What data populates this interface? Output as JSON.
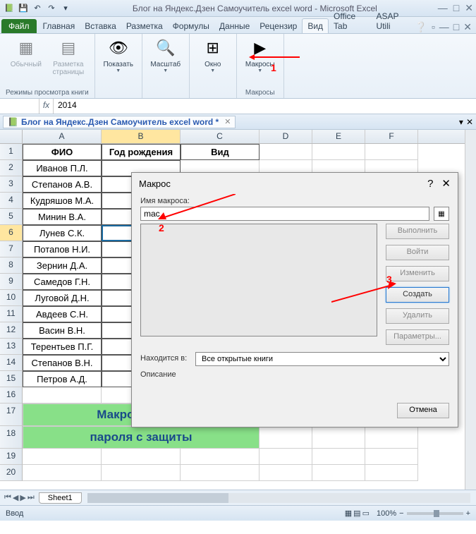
{
  "title": "Блог на Яндекс.Дзен Самоучитель excel word  -  Microsoft Excel",
  "tabs": {
    "file": "Файл",
    "items": [
      "Главная",
      "Вставка",
      "Разметка",
      "Формулы",
      "Данные",
      "Рецензир",
      "Вид",
      "Office Tab",
      "ASAP Utili"
    ],
    "active": "Вид"
  },
  "ribbon": {
    "group1_label": "Режимы просмотра книги",
    "btn_normal": "Обычный",
    "btn_layout": "Разметка страницы",
    "group2_label": "",
    "btn_show": "Показать",
    "group3_label": "",
    "btn_zoom": "Масштаб",
    "group4_label": "",
    "btn_window": "Окно",
    "group5_label": "Макросы",
    "btn_macros": "Макросы"
  },
  "formula": {
    "name": "",
    "value": "2014"
  },
  "doctab": {
    "name": "Блог на Яндекс.Дзен Самоучитель excel word *"
  },
  "columns": [
    "A",
    "B",
    "C",
    "D",
    "E",
    "F"
  ],
  "headers": {
    "a": "ФИО",
    "b": "Год рождения",
    "c": "Вид"
  },
  "rows": [
    {
      "n": 1
    },
    {
      "n": 2,
      "a": "Иванов П.Л."
    },
    {
      "n": 3,
      "a": "Степанов А.В."
    },
    {
      "n": 4,
      "a": "Кудряшов М.А."
    },
    {
      "n": 5,
      "a": "Минин В.А."
    },
    {
      "n": 6,
      "a": "Лунев С.К."
    },
    {
      "n": 7,
      "a": "Потапов Н.И."
    },
    {
      "n": 8,
      "a": "Зернин Д.А."
    },
    {
      "n": 9,
      "a": "Самедов Г.Н."
    },
    {
      "n": 10,
      "a": "Луговой Д.Н."
    },
    {
      "n": 11,
      "a": "Авдеев С.Н."
    },
    {
      "n": 12,
      "a": "Васин В.Н."
    },
    {
      "n": 13,
      "a": "Терентьев П.Г."
    },
    {
      "n": 14,
      "a": "Степанов В.Н."
    },
    {
      "n": 15,
      "a": "Петров А.Д."
    },
    {
      "n": 16
    },
    {
      "n": 17
    },
    {
      "n": 18
    },
    {
      "n": 19
    },
    {
      "n": 20
    }
  ],
  "merged_text_1": "Макрос снятия",
  "merged_text_2": "пароля с защиты",
  "sheet": "Sheet1",
  "status": "Ввод",
  "zoom": "100%",
  "dialog": {
    "title": "Макрос",
    "name_label": "Имя макроса:",
    "name_value": "mac",
    "location_label": "Находится в:",
    "location_value": "Все открытые книги",
    "desc_label": "Описание",
    "btn_run": "Выполнить",
    "btn_step": "Войти",
    "btn_edit": "Изменить",
    "btn_create": "Создать",
    "btn_delete": "Удалить",
    "btn_options": "Параметры...",
    "btn_cancel": "Отмена"
  },
  "anno": {
    "n1": "1",
    "n2": "2",
    "n3": "3"
  }
}
